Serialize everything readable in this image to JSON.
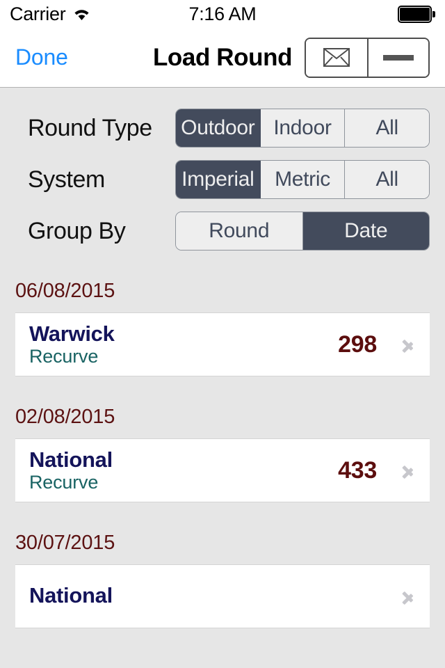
{
  "status_bar": {
    "carrier": "Carrier",
    "wifi_icon": "wifi-icon",
    "time": "7:16 AM",
    "battery_icon": "battery-full-icon"
  },
  "nav_bar": {
    "done_label": "Done",
    "title": "Load Round",
    "buttons": [
      {
        "icon": "envelope-icon",
        "name": "mail-button"
      },
      {
        "icon": "minus-icon",
        "name": "minus-button"
      }
    ]
  },
  "filters": [
    {
      "label": "Round Type",
      "name": "round-type",
      "options": [
        "Outdoor",
        "Indoor",
        "All"
      ],
      "selected": "Outdoor"
    },
    {
      "label": "System",
      "name": "system",
      "options": [
        "Imperial",
        "Metric",
        "All"
      ],
      "selected": "Imperial"
    },
    {
      "label": "Group By",
      "name": "group-by",
      "options": [
        "Round",
        "Date"
      ],
      "selected": "Date"
    }
  ],
  "list": {
    "groups": [
      {
        "header": "06/08/2015",
        "rows": [
          {
            "title": "Warwick",
            "subtitle": "Recurve",
            "score": "298"
          }
        ]
      },
      {
        "header": "02/08/2015",
        "rows": [
          {
            "title": "National",
            "subtitle": "Recurve",
            "score": "433"
          }
        ]
      },
      {
        "header": "30/07/2015",
        "rows": [
          {
            "title": "National",
            "subtitle": "",
            "score": ""
          }
        ]
      }
    ]
  },
  "colors": {
    "background": "#e6e6e6",
    "segment_selected": "#434b5c",
    "segment_unselected": "#eeeeee",
    "accent_link": "#1a8cff",
    "date_header": "#5c1212",
    "row_title": "#14145a",
    "row_subtitle": "#196363",
    "score": "#5c0e0e"
  }
}
